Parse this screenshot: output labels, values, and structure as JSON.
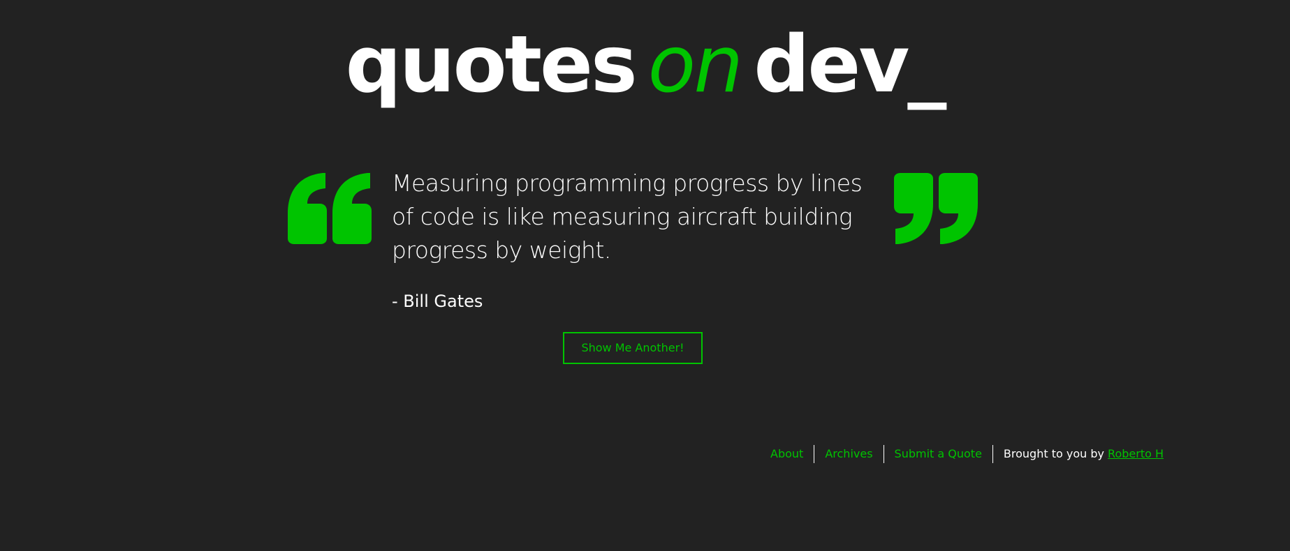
{
  "logo": {
    "word1": "quotes",
    "word2": "on",
    "word3": "dev_"
  },
  "quote": {
    "text": "Measuring programming progress by lines of code is like measuring aircraft building progress by weight.",
    "author": "- Bill Gates"
  },
  "button": {
    "label": "Show Me Another!"
  },
  "footer": {
    "links": [
      "About",
      "Archives",
      "Submit a Quote"
    ],
    "credit_prefix": "Brought to you by ",
    "credit_name": "Roberto H"
  },
  "colors": {
    "background": "#222222",
    "accent": "#00c400",
    "text": "#ffffff"
  },
  "icons": {
    "open_quote": "open-quote-icon",
    "close_quote": "close-quote-icon"
  }
}
